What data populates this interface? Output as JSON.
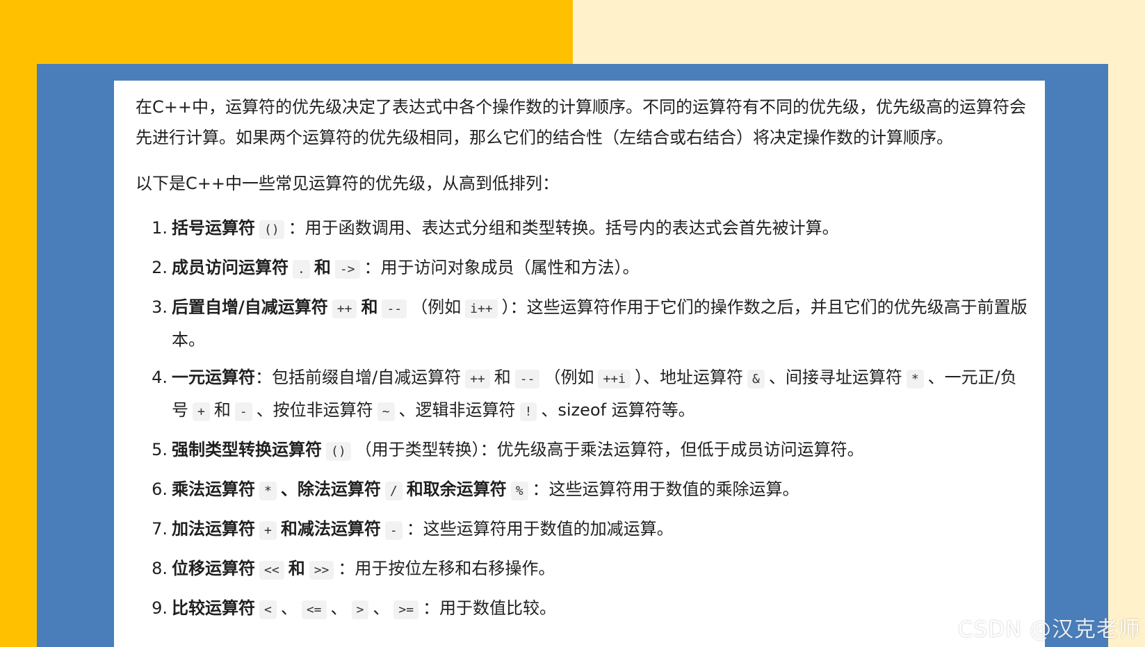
{
  "intro": "在C++中，运算符的优先级决定了表达式中各个操作数的计算顺序。不同的运算符有不同的优先级，优先级高的运算符会先进行计算。如果两个运算符的优先级相同，那么它们的结合性（左结合或右结合）将决定操作数的计算顺序。",
  "list_intro": "以下是C++中一些常见运算符的优先级，从高到低排列：",
  "items": [
    {
      "num": "1.",
      "parts": [
        {
          "t": "b",
          "v": "括号运算符"
        },
        {
          "t": "c",
          "v": "()"
        },
        {
          "t": "s",
          "v": "：用于函数调用、表达式分组和类型转换。括号内的表达式会首先被计算。"
        }
      ]
    },
    {
      "num": "2.",
      "parts": [
        {
          "t": "b",
          "v": "成员访问运算符"
        },
        {
          "t": "c",
          "v": "."
        },
        {
          "t": "b",
          "v": "和"
        },
        {
          "t": "c",
          "v": "->"
        },
        {
          "t": "s",
          "v": "：用于访问对象成员（属性和方法）。"
        }
      ]
    },
    {
      "num": "3.",
      "parts": [
        {
          "t": "b",
          "v": "后置自增/自减运算符"
        },
        {
          "t": "c",
          "v": "++"
        },
        {
          "t": "b",
          "v": "和"
        },
        {
          "t": "c",
          "v": "--"
        },
        {
          "t": "s",
          "v": "（例如"
        },
        {
          "t": "c",
          "v": "i++"
        },
        {
          "t": "s",
          "v": "）：这些运算符作用于它们的操作数之后，并且它们的优先级高于前置版本。"
        }
      ]
    },
    {
      "num": "4.",
      "parts": [
        {
          "t": "b",
          "v": "一元运算符"
        },
        {
          "t": "s",
          "v": "：包括前缀自增/自减运算符"
        },
        {
          "t": "c",
          "v": "++"
        },
        {
          "t": "s",
          "v": "和"
        },
        {
          "t": "c",
          "v": "--"
        },
        {
          "t": "s",
          "v": "（例如"
        },
        {
          "t": "c",
          "v": "++i"
        },
        {
          "t": "s",
          "v": "）、地址运算符"
        },
        {
          "t": "c",
          "v": "&"
        },
        {
          "t": "s",
          "v": "、间接寻址运算符"
        },
        {
          "t": "c",
          "v": "*"
        },
        {
          "t": "s",
          "v": "、一元正/负号"
        },
        {
          "t": "c",
          "v": "+"
        },
        {
          "t": "s",
          "v": "和"
        },
        {
          "t": "c",
          "v": "-"
        },
        {
          "t": "s",
          "v": "、按位非运算符"
        },
        {
          "t": "c",
          "v": "~"
        },
        {
          "t": "s",
          "v": "、逻辑非运算符"
        },
        {
          "t": "c",
          "v": "!"
        },
        {
          "t": "s",
          "v": "、sizeof 运算符等。"
        }
      ]
    },
    {
      "num": "5.",
      "parts": [
        {
          "t": "b",
          "v": "强制类型转换运算符"
        },
        {
          "t": "c",
          "v": "()"
        },
        {
          "t": "s",
          "v": "（用于类型转换）：优先级高于乘法运算符，但低于成员访问运算符。"
        }
      ]
    },
    {
      "num": "6.",
      "parts": [
        {
          "t": "b",
          "v": "乘法运算符"
        },
        {
          "t": "c",
          "v": "*"
        },
        {
          "t": "b",
          "v": "、除法运算符"
        },
        {
          "t": "c",
          "v": "/"
        },
        {
          "t": "b",
          "v": "和取余运算符"
        },
        {
          "t": "c",
          "v": "%"
        },
        {
          "t": "s",
          "v": "：这些运算符用于数值的乘除运算。"
        }
      ]
    },
    {
      "num": "7.",
      "parts": [
        {
          "t": "b",
          "v": "加法运算符"
        },
        {
          "t": "c",
          "v": "+"
        },
        {
          "t": "b",
          "v": "和减法运算符"
        },
        {
          "t": "c",
          "v": "-"
        },
        {
          "t": "s",
          "v": "：这些运算符用于数值的加减运算。"
        }
      ]
    },
    {
      "num": "8.",
      "parts": [
        {
          "t": "b",
          "v": "位移运算符"
        },
        {
          "t": "c",
          "v": "<<"
        },
        {
          "t": "b",
          "v": "和"
        },
        {
          "t": "c",
          "v": ">>"
        },
        {
          "t": "s",
          "v": "：用于按位左移和右移操作。"
        }
      ]
    },
    {
      "num": "9.",
      "parts": [
        {
          "t": "b",
          "v": "比较运算符"
        },
        {
          "t": "c",
          "v": "<"
        },
        {
          "t": "s",
          "v": "、"
        },
        {
          "t": "c",
          "v": "<="
        },
        {
          "t": "s",
          "v": "、"
        },
        {
          "t": "c",
          "v": ">"
        },
        {
          "t": "s",
          "v": "、"
        },
        {
          "t": "c",
          "v": ">="
        },
        {
          "t": "s",
          "v": "：用于数值比较。"
        }
      ]
    }
  ],
  "watermark": "CSDN @汉克老师",
  "colors": {
    "yellow": "#FFC000",
    "cream": "#FFF1C9",
    "blue": "#4A7EBB"
  }
}
